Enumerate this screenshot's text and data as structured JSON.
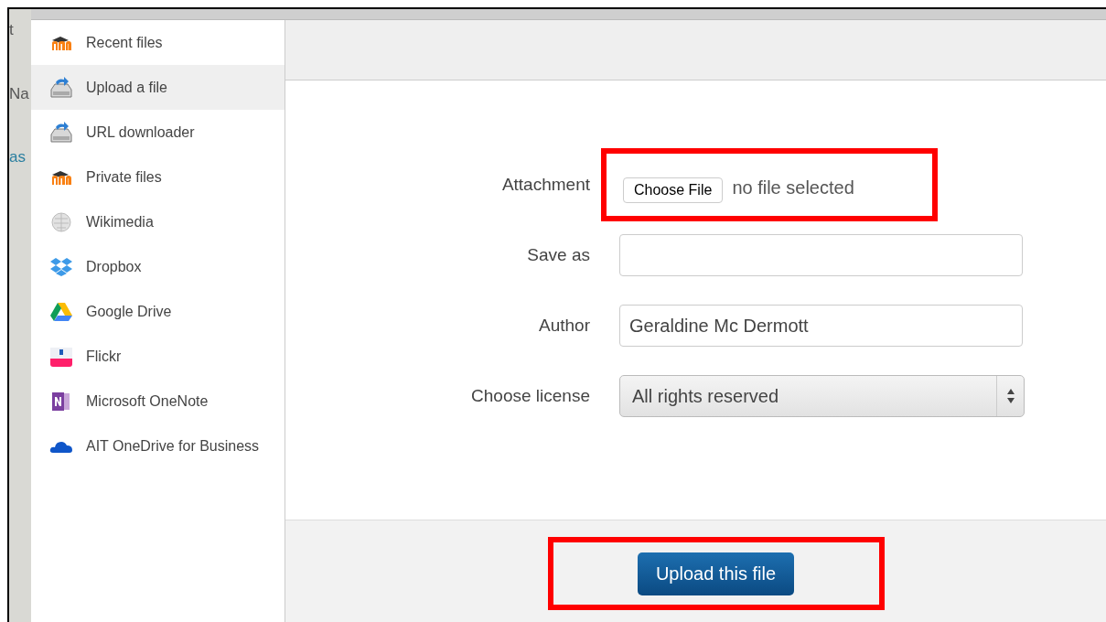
{
  "background_fragments": [
    "t",
    "Na",
    "as"
  ],
  "sidebar": {
    "items": [
      {
        "label": "Recent files",
        "kind": "moodle",
        "selected": false
      },
      {
        "label": "Upload a file",
        "kind": "upload",
        "selected": true
      },
      {
        "label": "URL downloader",
        "kind": "upload",
        "selected": false
      },
      {
        "label": "Private files",
        "kind": "moodle",
        "selected": false
      },
      {
        "label": "Wikimedia",
        "kind": "wikimedia",
        "selected": false
      },
      {
        "label": "Dropbox",
        "kind": "dropbox",
        "selected": false
      },
      {
        "label": "Google Drive",
        "kind": "drive",
        "selected": false
      },
      {
        "label": "Flickr",
        "kind": "flickr",
        "selected": false
      },
      {
        "label": "Microsoft OneNote",
        "kind": "onenote",
        "selected": false
      },
      {
        "label": "AIT OneDrive for Business",
        "kind": "onedrive",
        "selected": false
      }
    ]
  },
  "form": {
    "fields": [
      {
        "kind": "file",
        "label": "Attachment",
        "button": "Choose File",
        "status": "no file selected",
        "highlighted": true
      },
      {
        "kind": "text",
        "label": "Save as"
      },
      {
        "kind": "text",
        "label": "Author",
        "value": "Geraldine Mc Dermott"
      },
      {
        "kind": "select",
        "label": "Choose license",
        "value": "All rights reserved"
      }
    ]
  },
  "footer": {
    "button": "Upload this file",
    "highlighted": true
  }
}
